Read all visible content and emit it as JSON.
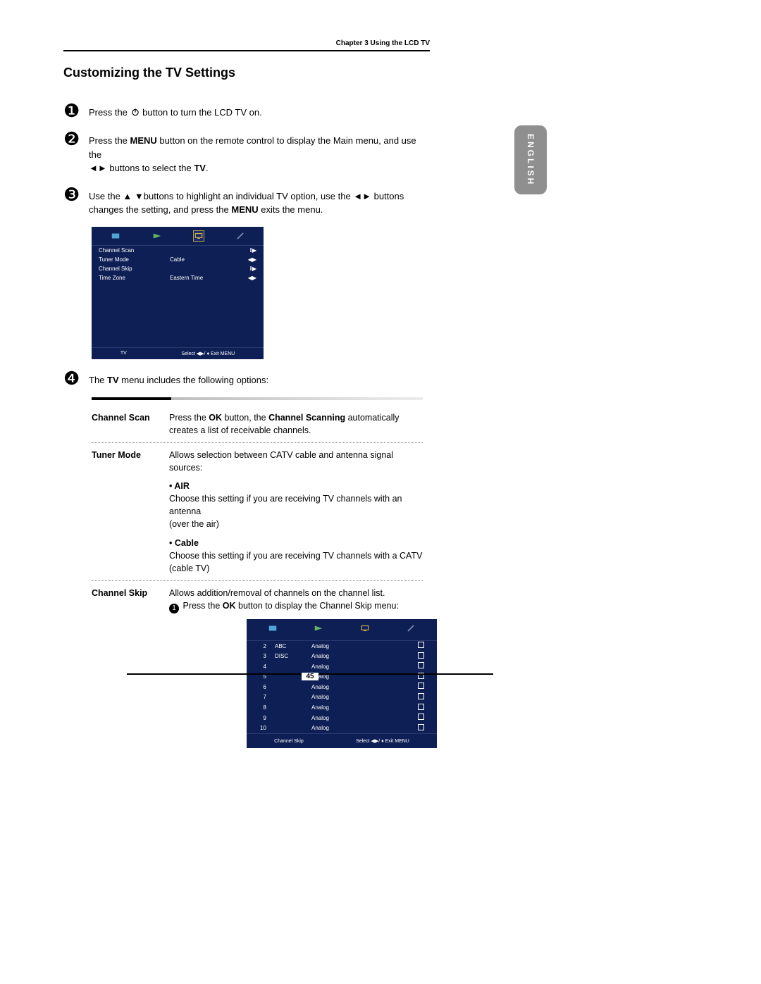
{
  "header": {
    "chapter": "Chapter 3 Using the LCD TV"
  },
  "language_tab": "ENGLISH",
  "section_title": "Customizing the TV Settings",
  "steps": {
    "s1": {
      "pre": "Press the ",
      "post": " button to turn the LCD TV on."
    },
    "s2": {
      "l1a": "Press the ",
      "l1b": "MENU",
      "l1c": " button on the remote control to display the Main menu, and use the",
      "l2a": "◄► buttons to select the ",
      "l2b": "TV",
      "l2c": "."
    },
    "s3": {
      "l1": "Use the  ▲ ▼buttons to highlight an individual TV option, use the ◄► buttons",
      "l2a": "changes the setting, and press the ",
      "l2b": "MENU",
      "l2c": " exits the menu."
    },
    "s4": {
      "pre": "The ",
      "b": "TV",
      "post": " menu includes the following options:"
    }
  },
  "osd1": {
    "rows": [
      {
        "label": "Channel Scan",
        "value": "",
        "ctrl": "‖▶"
      },
      {
        "label": "Tuner Mode",
        "value": "Cable",
        "ctrl": "◀▶"
      },
      {
        "label": "Channel Skip",
        "value": "",
        "ctrl": "‖▶"
      },
      {
        "label": "Time Zone",
        "value": "Eastern Time",
        "ctrl": "◀▶"
      }
    ],
    "footer": {
      "left": "TV",
      "mid": "Select  ◀▶/ ♦  Exit  MENU"
    }
  },
  "options": {
    "channel_scan": {
      "label": "Channel Scan",
      "d1a": "Press the ",
      "d1b": "OK",
      "d1c": " button, the ",
      "d1d": "Channel Scanning",
      "d1e": " automatically",
      "d2": "creates a list of receivable channels."
    },
    "tuner_mode": {
      "label": "Tuner Mode",
      "d1": "Allows selection between CATV cable and antenna signal sources:",
      "air": {
        "hdr": "AIR",
        "l1": "Choose this setting if you are receiving TV channels with an antenna",
        "l2": "(over the air)"
      },
      "cable": {
        "hdr": "Cable",
        "l1": "Choose this setting if you are receiving TV channels with a CATV",
        "l2": "(cable TV)"
      }
    },
    "channel_skip": {
      "label": "Channel Skip",
      "d1": "Allows addition/removal of channels on the channel list.",
      "d2a": "Press the ",
      "d2b": "OK",
      "d2c": " button to display the Channel Skip menu:"
    }
  },
  "osd2": {
    "rows": [
      {
        "num": "2",
        "name": "ABC",
        "type": "Analog"
      },
      {
        "num": "3",
        "name": "DISC",
        "type": "Analog"
      },
      {
        "num": "4",
        "name": "",
        "type": "Analog"
      },
      {
        "num": "5",
        "name": "",
        "type": "Analog"
      },
      {
        "num": "6",
        "name": "",
        "type": "Analog"
      },
      {
        "num": "7",
        "name": "",
        "type": "Analog"
      },
      {
        "num": "8",
        "name": "",
        "type": "Analog"
      },
      {
        "num": "9",
        "name": "",
        "type": "Analog"
      },
      {
        "num": "10",
        "name": "",
        "type": "Analog"
      }
    ],
    "footer": {
      "left": "Channel Skip",
      "mid": "Select  ◀▶/ ♦   Exit MENU"
    }
  },
  "page_number": "45"
}
